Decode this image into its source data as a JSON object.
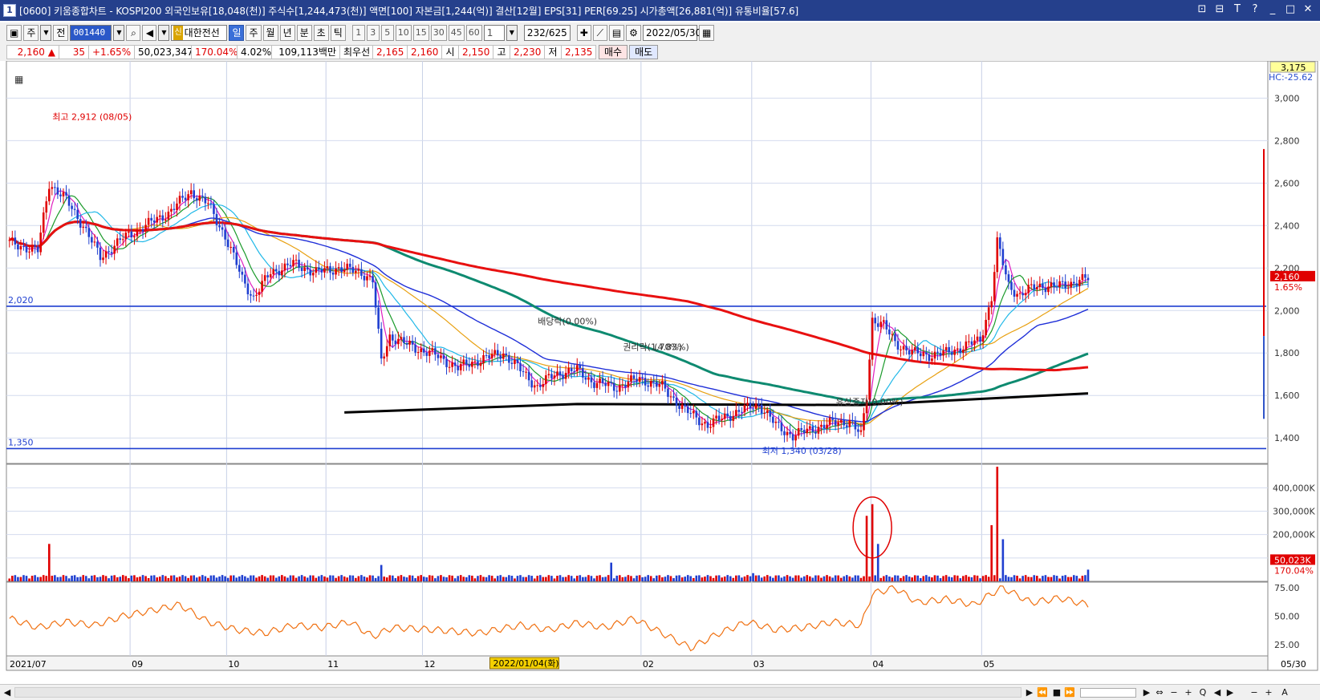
{
  "window": {
    "number": "1",
    "title": "[0600] 키움종합차트 - KOSPI200 외국인보유[18,048(천)] 주식수[1,244,473(천)] 액면[100] 자본금[1,244(억)] 결산[12월] EPS[31] PER[69.25] 시가총액[26,881(억)] 유통비율[57.6]",
    "controls": [
      "⊡",
      "⊟",
      "T",
      "?",
      "_",
      "□",
      "✕"
    ]
  },
  "toolbar": {
    "market_select": "주",
    "prev_label": "전",
    "code": "001440",
    "stock_badge": "신",
    "stock_name": "대한전선",
    "periods": [
      "일",
      "주",
      "월",
      "년",
      "분",
      "초",
      "틱"
    ],
    "active_period": "일",
    "minute_steps": [
      "1",
      "3",
      "5",
      "10",
      "15",
      "30",
      "45",
      "60"
    ],
    "step_value": "1",
    "position": "232/625",
    "date": "2022/05/30"
  },
  "quote": {
    "price": "2,160",
    "change": "35",
    "change_pct": "+1.65%",
    "volume": "50,023,347",
    "volume_ratio": "170.04%",
    "turnover": "4.02%",
    "amount": "109,113백만",
    "best_label": "최우선",
    "best_ask": "2,165",
    "best_bid": "2,160",
    "open_label": "시",
    "open": "2,150",
    "high_label": "고",
    "high": "2,230",
    "low_label": "저",
    "low": "2,135",
    "buy_label": "매수",
    "sell_label": "매도"
  },
  "chart_data": {
    "type": "candlestick",
    "price_axis": {
      "ticks": [
        "3,000",
        "2,800",
        "2,600",
        "2,400",
        "2,200",
        "2,000",
        "1,800",
        "1,600",
        "1,400"
      ],
      "tick_values": [
        3000,
        2800,
        2600,
        2400,
        2200,
        2000,
        1800,
        1600,
        1400
      ],
      "range": [
        1280,
        3175
      ],
      "top_label": "3,175",
      "hc_label": "HC:-25.62",
      "last_price_label": "2,160",
      "last_change_label": "1.65%"
    },
    "volume_axis": {
      "ticks": [
        "400,000K",
        "300,000K",
        "200,000K",
        "100,000K"
      ],
      "tick_values": [
        400000,
        300000,
        200000,
        100000
      ],
      "range": [
        0,
        480000
      ],
      "last_volume_label": "50,023K",
      "last_ratio_label": "170.04%"
    },
    "osc_axis": {
      "ticks": [
        "75.00",
        "50.00",
        "25.00"
      ],
      "tick_values": [
        75,
        50,
        25
      ],
      "range": [
        15,
        80
      ]
    },
    "x_labels": [
      "2021/07",
      "09",
      "10",
      "11",
      "12",
      "02",
      "03",
      "04",
      "05"
    ],
    "x_label_index": [
      0,
      43,
      77,
      112,
      146,
      223,
      262,
      304,
      343
    ],
    "highlight_date_label": "2022/01/04(화)",
    "highlight_date_index": 180,
    "date_axis_end_label": "05/30",
    "total_bars": 441,
    "horizontal_lines": [
      {
        "label": "2,020",
        "value": 2020
      },
      {
        "label": "1,350",
        "value": 1350
      }
    ],
    "annotations": [
      {
        "text": "최고 2,912 (08/05)",
        "index": 14,
        "value": 2912
      },
      {
        "text": "최저 1,340 (03/28)",
        "index": 264,
        "value": 1340
      },
      {
        "text": "배당락(0.00%)",
        "index": 185,
        "value": 1950
      },
      {
        "text": "권리락(1.70%)",
        "index": 215,
        "value": 1830
      },
      {
        "text": "(4.83%)",
        "index": 226,
        "value": 1830
      },
      {
        "text": "유상증자(0.00%)",
        "index": 290,
        "value": 1570
      }
    ],
    "ohlc_keypoints": [
      [
        0,
        2320
      ],
      [
        10,
        2280
      ],
      [
        14,
        2600
      ],
      [
        20,
        2520
      ],
      [
        26,
        2400
      ],
      [
        32,
        2250
      ],
      [
        40,
        2340
      ],
      [
        48,
        2400
      ],
      [
        56,
        2460
      ],
      [
        64,
        2560
      ],
      [
        70,
        2500
      ],
      [
        76,
        2350
      ],
      [
        82,
        2150
      ],
      [
        86,
        2060
      ],
      [
        92,
        2180
      ],
      [
        100,
        2220
      ],
      [
        108,
        2180
      ],
      [
        116,
        2200
      ],
      [
        124,
        2180
      ],
      [
        128,
        2140
      ],
      [
        131,
        1760
      ],
      [
        134,
        1880
      ],
      [
        140,
        1840
      ],
      [
        150,
        1790
      ],
      [
        158,
        1730
      ],
      [
        166,
        1770
      ],
      [
        174,
        1800
      ],
      [
        180,
        1720
      ],
      [
        186,
        1640
      ],
      [
        192,
        1700
      ],
      [
        200,
        1720
      ],
      [
        206,
        1660
      ],
      [
        214,
        1640
      ],
      [
        222,
        1680
      ],
      [
        230,
        1640
      ],
      [
        238,
        1530
      ],
      [
        246,
        1460
      ],
      [
        252,
        1500
      ],
      [
        258,
        1530
      ],
      [
        264,
        1560
      ],
      [
        270,
        1460
      ],
      [
        276,
        1410
      ],
      [
        282,
        1440
      ],
      [
        290,
        1470
      ],
      [
        296,
        1480
      ],
      [
        300,
        1410
      ],
      [
        302,
        1600
      ],
      [
        304,
        1960
      ],
      [
        308,
        1930
      ],
      [
        312,
        1850
      ],
      [
        318,
        1800
      ],
      [
        324,
        1790
      ],
      [
        330,
        1800
      ],
      [
        336,
        1830
      ],
      [
        342,
        1860
      ],
      [
        346,
        2060
      ],
      [
        348,
        2320
      ],
      [
        352,
        2120
      ],
      [
        356,
        2070
      ],
      [
        362,
        2120
      ],
      [
        368,
        2110
      ],
      [
        374,
        2130
      ],
      [
        380,
        2150
      ]
    ],
    "volume_spikes": [
      {
        "index": 14,
        "value": 160000
      },
      {
        "index": 131,
        "value": 70000
      },
      {
        "index": 212,
        "value": 80000
      },
      {
        "index": 262,
        "value": 35000
      },
      {
        "index": 302,
        "value": 280000
      },
      {
        "index": 304,
        "value": 330000
      },
      {
        "index": 306,
        "value": 160000
      },
      {
        "index": 346,
        "value": 240000
      },
      {
        "index": 348,
        "value": 490000
      },
      {
        "index": 350,
        "value": 180000
      }
    ],
    "last_volume": 50023,
    "oscillator_keypoints": [
      [
        0,
        48
      ],
      [
        10,
        40
      ],
      [
        20,
        45
      ],
      [
        30,
        42
      ],
      [
        40,
        50
      ],
      [
        50,
        55
      ],
      [
        60,
        60
      ],
      [
        70,
        45
      ],
      [
        80,
        38
      ],
      [
        90,
        35
      ],
      [
        100,
        42
      ],
      [
        110,
        40
      ],
      [
        120,
        45
      ],
      [
        128,
        32
      ],
      [
        135,
        40
      ],
      [
        150,
        38
      ],
      [
        165,
        35
      ],
      [
        180,
        42
      ],
      [
        190,
        38
      ],
      [
        200,
        44
      ],
      [
        210,
        40
      ],
      [
        220,
        48
      ],
      [
        230,
        35
      ],
      [
        240,
        22
      ],
      [
        250,
        35
      ],
      [
        260,
        45
      ],
      [
        270,
        38
      ],
      [
        280,
        40
      ],
      [
        290,
        45
      ],
      [
        300,
        42
      ],
      [
        304,
        70
      ],
      [
        312,
        75
      ],
      [
        320,
        62
      ],
      [
        330,
        65
      ],
      [
        340,
        60
      ],
      [
        346,
        70
      ],
      [
        350,
        75
      ],
      [
        360,
        62
      ],
      [
        370,
        66
      ],
      [
        380,
        60
      ]
    ]
  }
}
